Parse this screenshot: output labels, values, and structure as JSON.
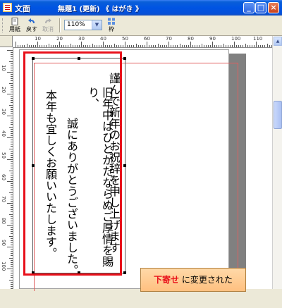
{
  "window": {
    "app_title": "文面",
    "doc_title": "無題1 (更新) 《 はがき 》",
    "min_label": "_",
    "max_label": "□",
    "close_label": "×"
  },
  "toolbar": {
    "paper_label": "用紙",
    "undo_label": "戻す",
    "redo_label": "取消",
    "zoom_value": "110%",
    "frame_label": "枠"
  },
  "document": {
    "lines": [
      "謹んで新年のお祝辞を申し上げます",
      "旧年中はひとかたならぬご厚情を賜り、",
      "誠にありがとうございました。",
      "本年も宜しくお願いいたします。"
    ]
  },
  "callout": {
    "highlight": "下寄せ",
    "text": "に変更された"
  },
  "ruler": {
    "top_numbers": [
      "10",
      "20",
      "30",
      "40",
      "50",
      "60",
      "70",
      "80",
      "90",
      "100",
      "110"
    ],
    "left_numbers": [
      "10",
      "20",
      "30",
      "40",
      "50",
      "60",
      "70",
      "80",
      "90",
      "100",
      "110",
      "120",
      "130",
      "140"
    ]
  },
  "colors": {
    "title_blue": "#0054e3",
    "highlight_red": "#e8101a",
    "callout_fill": "#ffc080"
  }
}
